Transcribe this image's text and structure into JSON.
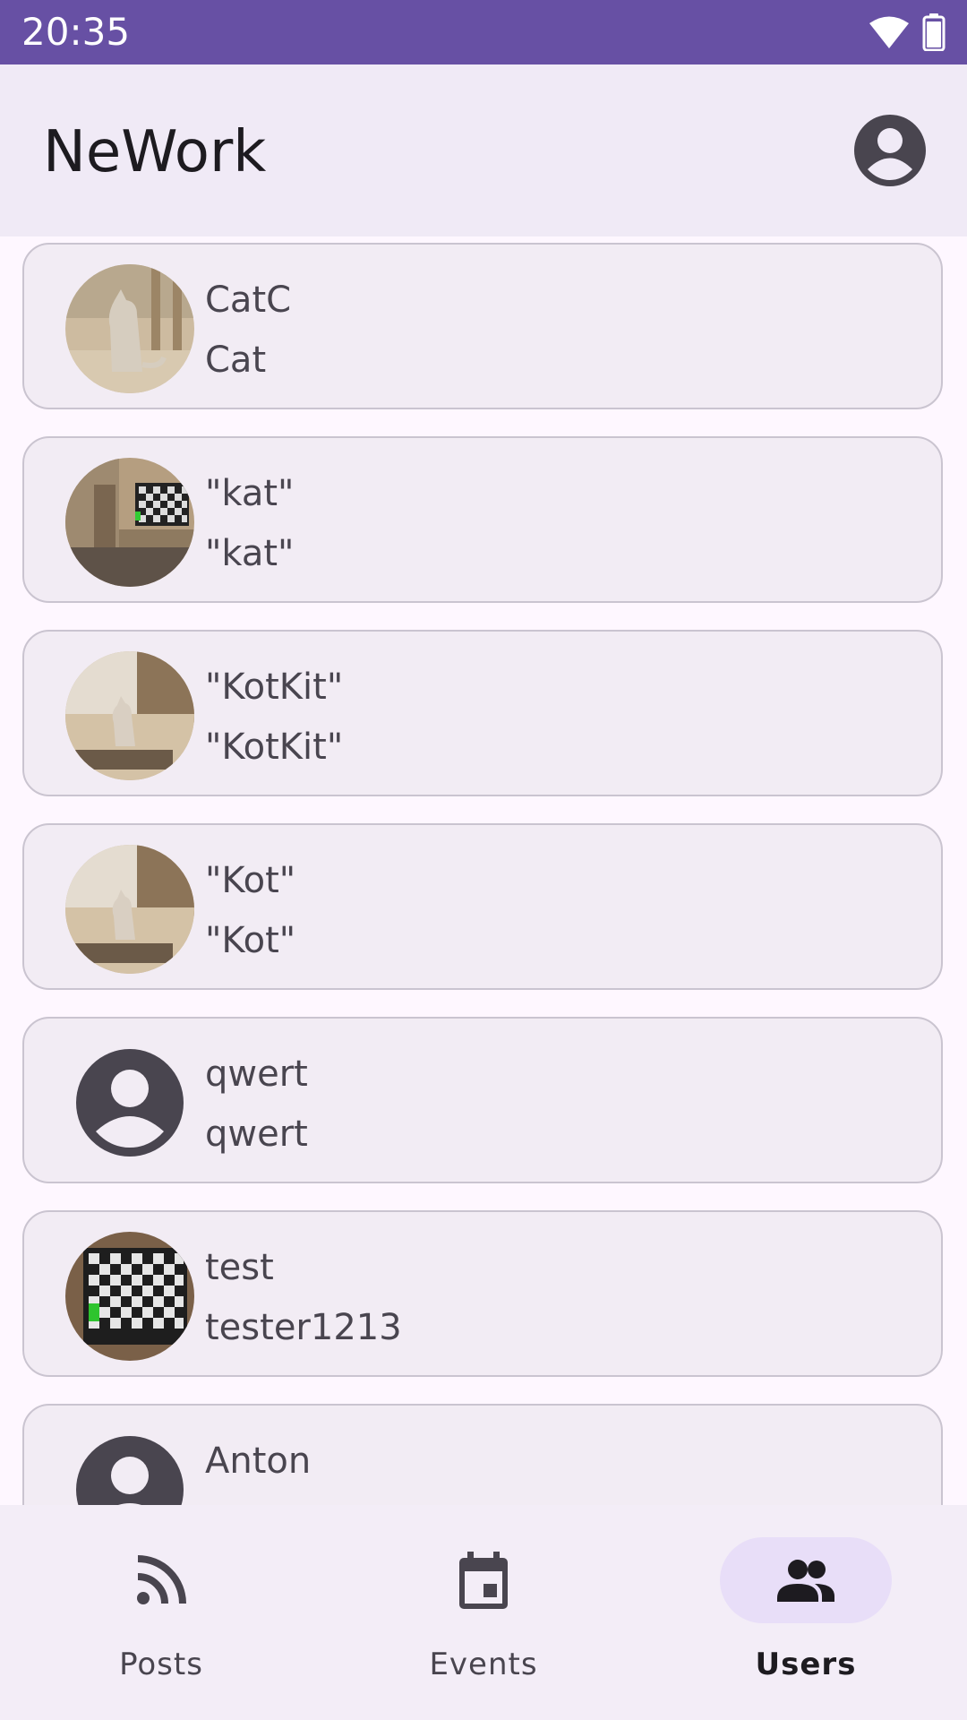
{
  "status_bar": {
    "time": "20:35",
    "icons": [
      "wifi-icon",
      "battery-icon"
    ],
    "background": "#6750A4"
  },
  "app_bar": {
    "title": "NeWork",
    "account_icon": "account-circle-icon"
  },
  "users": [
    {
      "name": "CatC",
      "login": "Cat",
      "avatar": "photo-cat-room"
    },
    {
      "name": "\"kat\"",
      "login": "\"kat\"",
      "avatar": "photo-tv-room"
    },
    {
      "name": "\"KotKit\"",
      "login": "\"KotKit\"",
      "avatar": "photo-cat-window"
    },
    {
      "name": "\"Kot\"",
      "login": "\"Kot\"",
      "avatar": "photo-cat-window"
    },
    {
      "name": "qwert",
      "login": "qwert",
      "avatar": "account-circle-icon"
    },
    {
      "name": "test",
      "login": "tester1213",
      "avatar": "photo-tv-checker"
    },
    {
      "name": "Anton",
      "login": "",
      "avatar": "account-circle-icon"
    }
  ],
  "bottom_nav": {
    "items": [
      {
        "label": "Posts",
        "icon": "feed-icon",
        "active": false
      },
      {
        "label": "Events",
        "icon": "event-icon",
        "active": false
      },
      {
        "label": "Users",
        "icon": "group-icon",
        "active": true
      }
    ]
  },
  "colors": {
    "primary": "#6750A4",
    "surface": "#FEF7FF",
    "card": "#F2ECF4",
    "outline": "#CAC4D0",
    "indicator": "#E8DEF8",
    "on_surface": "#1D1B20",
    "on_surface_variant": "#49454F"
  }
}
